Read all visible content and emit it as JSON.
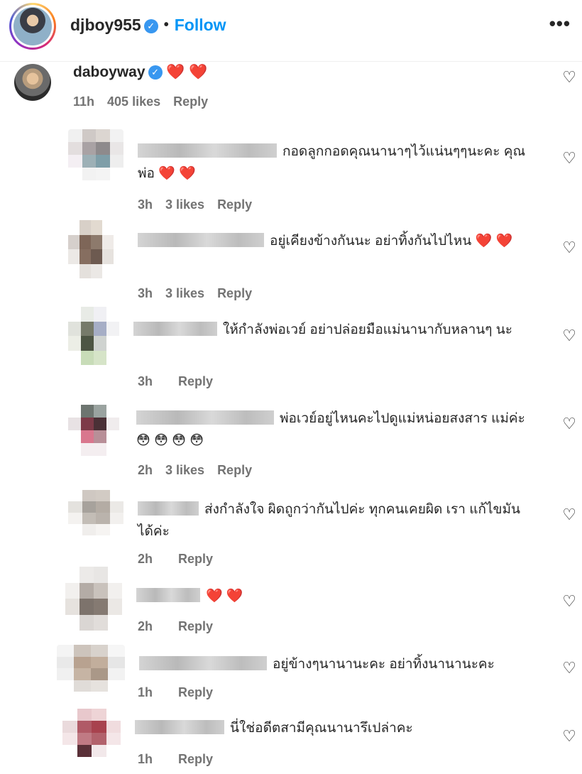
{
  "header": {
    "username": "djboy955",
    "verified_mark": "✓",
    "separator": "•",
    "follow_label": "Follow",
    "more_icon": "more-horizontal-icon",
    "more_glyph": "•••"
  },
  "colors": {
    "accent": "#0095f6",
    "verified": "#3897f0",
    "heart": "#f03e6b",
    "meta": "#737373"
  },
  "like_icon_glyph": "♡",
  "comments": [
    {
      "username": "daboyway",
      "verified": true,
      "text": "",
      "emoji": "❤️ ❤️",
      "time": "11h",
      "likes": "405 likes",
      "reply": "Reply"
    },
    {
      "username": "",
      "text": "กอดลูกกอดคุณนานาๆไว้แน่นๆๆนะคะ คุณพ่อ",
      "emoji": "❤️ ❤️",
      "time": "3h",
      "likes": "3 likes",
      "reply": "Reply"
    },
    {
      "username": "",
      "text": "อยู่เคียงข้างกันนะ อย่าทิ้งกันไปไหน",
      "emoji": "❤️ ❤️",
      "time": "3h",
      "likes": "3 likes",
      "reply": "Reply"
    },
    {
      "username": "",
      "text": "ให้กำลังพ่อเวย์ อย่าปล่อยมือแม่นานากับหลานๆ นะ",
      "emoji": "",
      "time": "3h",
      "likes": "",
      "reply": "Reply"
    },
    {
      "username": "",
      "text": "พ่อเวย์อยู่ไหนคะไปดูแม่หน่อยสงสาร แม่ค่ะ",
      "emoji": "😳 😳 😳 😳",
      "time": "2h",
      "likes": "3 likes",
      "reply": "Reply"
    },
    {
      "username": "",
      "text": "ส่งกำลังใจ ผิดถูกว่ากันไปค่ะ ทุกคนเคยผิด เรา แก้ไขมันได้ค่ะ",
      "emoji": "",
      "time": "2h",
      "likes": "",
      "reply": "Reply"
    },
    {
      "username": "",
      "text": "",
      "emoji": "❤️ ❤️",
      "time": "2h",
      "likes": "",
      "reply": "Reply"
    },
    {
      "username": "",
      "text": "อยู่ข้างๆนานานะคะ อย่าทิ้งนานานะคะ",
      "emoji": "",
      "time": "1h",
      "likes": "",
      "reply": "Reply"
    },
    {
      "username": "",
      "text": "นี่ใช่อดีตสามีคุณนานารึเปล่าคะ",
      "emoji": "",
      "time": "1h",
      "likes": "",
      "reply": "Reply"
    }
  ]
}
